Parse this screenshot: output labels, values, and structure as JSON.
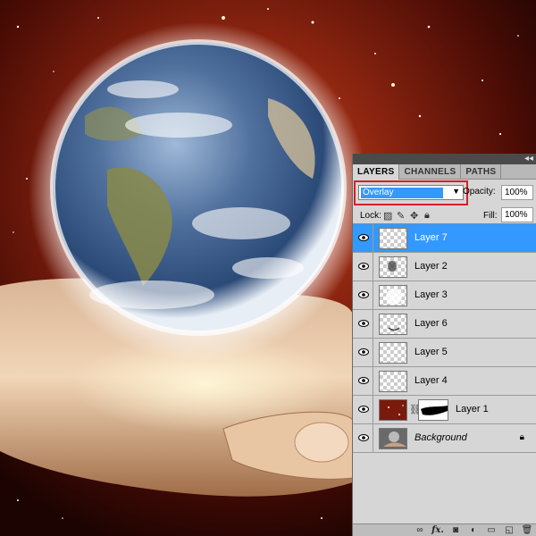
{
  "panel": {
    "collapse_icon": "collapse-arrows-icon",
    "tabs": [
      {
        "label": "LAYERS",
        "active": true
      },
      {
        "label": "CHANNELS",
        "active": false
      },
      {
        "label": "PATHS",
        "active": false
      }
    ],
    "blend_mode": "Overlay",
    "opacity_label": "Opacity:",
    "opacity_value": "100%",
    "lock_label": "Lock:",
    "lock_icons": [
      "lock-transparent-icon",
      "lock-brush-icon",
      "lock-move-icon",
      "lock-all-icon"
    ],
    "fill_label": "Fill:",
    "fill_value": "100%",
    "highlight_color": "#d81f26",
    "selected_color": "#3399ff"
  },
  "layers": [
    {
      "name": "Layer 7",
      "selected": true
    },
    {
      "name": "Layer 2",
      "selected": false
    },
    {
      "name": "Layer 3",
      "selected": false
    },
    {
      "name": "Layer 6",
      "selected": false
    },
    {
      "name": "Layer 5",
      "selected": false
    },
    {
      "name": "Layer 4",
      "selected": false
    },
    {
      "name": "Layer 1",
      "selected": false,
      "has_mask": true
    },
    {
      "name": "Background",
      "selected": false,
      "locked": true
    }
  ],
  "bottom_icons": [
    "link-layers-icon",
    "fx-icon",
    "add-mask-icon",
    "adjustment-layer-icon",
    "new-group-icon",
    "new-layer-icon",
    "trash-icon"
  ],
  "bottom_fx_label": "fx."
}
